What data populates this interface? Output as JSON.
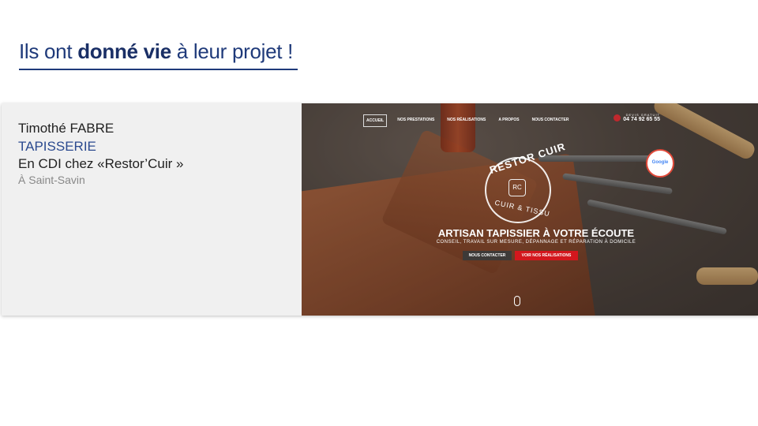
{
  "heading": {
    "part1": "Ils ont ",
    "bold": "donné vie",
    "part2": " à leur projet !"
  },
  "person": {
    "name": "Timothé FABRE",
    "trade": "TAPISSERIE",
    "job": "En CDI chez «Restor’Cuir »",
    "location": "À  Saint-Savin"
  },
  "website": {
    "nav": [
      "ACCUEIL",
      "NOS PRESTATIONS",
      "NOS RÉALISATIONS",
      "A PROPOS",
      "NOUS CONTACTER"
    ],
    "phone_caption": "DEVIS GRATUIT",
    "phone": "04 74 92 65 55",
    "badge": "Google",
    "logo_top": "RESTOR CUIR",
    "logo_bottom": "CUIR & TISSU",
    "logo_mono": "RC",
    "headline": "ARTISAN TAPISSIER À VOTRE ÉCOUTE",
    "subline": "CONSEIL, TRAVAIL SUR MESURE, DÉPANNAGE ET RÉPARATION À DOMICILE",
    "button_contact": "NOUS CONTACTER",
    "button_work": "VOIR NOS RÉALISATIONS"
  },
  "colors": {
    "title": "#1f3a7a",
    "trade": "#2b4a8f",
    "cta": "#d3171d"
  }
}
